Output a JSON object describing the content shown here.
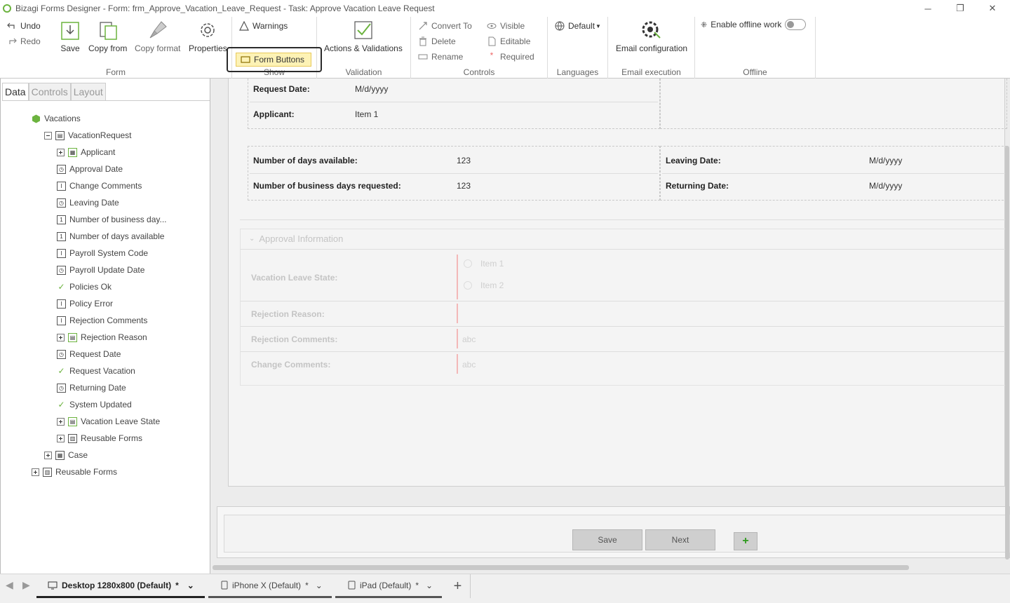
{
  "window": {
    "title": "Bizagi Forms Designer  - Form: frm_Approve_Vacation_Leave_Request - Task:  Approve Vacation Leave Request",
    "minimize": "─",
    "restore": "❐",
    "close": "✕"
  },
  "ribbon": {
    "form": {
      "undo": "Undo",
      "redo": "Redo",
      "save": "Save",
      "copy_from": "Copy from",
      "copy_format": "Copy format",
      "properties": "Properties",
      "label": "Form"
    },
    "show": {
      "warnings": "Warnings",
      "form_buttons": "Form Buttons",
      "label": "Show"
    },
    "validation": {
      "actions": "Actions & Validations",
      "label": "Validation"
    },
    "controls": {
      "convert_to": "Convert To",
      "delete": "Delete",
      "rename": "Rename",
      "visible": "Visible",
      "editable": "Editable",
      "required": "Required",
      "label": "Controls"
    },
    "languages": {
      "default": "Default",
      "label": "Languages"
    },
    "email": {
      "config": "Email configuration",
      "label": "Email execution"
    },
    "offline": {
      "enable": "Enable offline work",
      "label": "Offline"
    }
  },
  "left_panel": {
    "tabs": [
      "Data",
      "Controls",
      "Layout"
    ],
    "tree": [
      {
        "label": "Vacations"
      },
      {
        "label": "VacationRequest"
      },
      {
        "label": "Applicant"
      },
      {
        "label": "Approval Date"
      },
      {
        "label": "Change Comments"
      },
      {
        "label": "Leaving Date"
      },
      {
        "label": "Number of business day..."
      },
      {
        "label": "Number of days available"
      },
      {
        "label": "Payroll System Code"
      },
      {
        "label": "Payroll Update Date"
      },
      {
        "label": "Policies Ok"
      },
      {
        "label": "Policy Error"
      },
      {
        "label": "Rejection Comments"
      },
      {
        "label": "Rejection Reason"
      },
      {
        "label": "Request Date"
      },
      {
        "label": "Request Vacation"
      },
      {
        "label": "Returning Date"
      },
      {
        "label": "System Updated"
      },
      {
        "label": "Vacation Leave State"
      },
      {
        "label": "Reusable Forms"
      },
      {
        "label": "Case"
      },
      {
        "label": "Reusable Forms"
      }
    ]
  },
  "form": {
    "request_date": {
      "label": "Request Date:",
      "value": "M/d/yyyy"
    },
    "applicant": {
      "label": "Applicant:",
      "value": "Item 1"
    },
    "days_available": {
      "label": "Number of days available:",
      "value": "123"
    },
    "business_days": {
      "label": "Number of business days requested:",
      "value": "123"
    },
    "leaving_date": {
      "label": "Leaving Date:",
      "value": "M/d/yyyy"
    },
    "returning_date": {
      "label": "Returning Date:",
      "value": "M/d/yyyy"
    },
    "approval_group": {
      "title": "Approval Information",
      "state_label": "Vacation Leave State:",
      "state_options": [
        "Item 1",
        "Item 2"
      ],
      "rejection_reason_label": "Rejection Reason:",
      "rejection_comments_label": "Rejection Comments:",
      "rejection_comments_value": "abc",
      "change_comments_label": "Change Comments:",
      "change_comments_value": "abc"
    },
    "buttons": {
      "save": "Save",
      "next": "Next",
      "add": "+"
    }
  },
  "bottom_tabs": [
    {
      "label": "Desktop 1280x800 (Default)",
      "modified": "*"
    },
    {
      "label": "iPhone X (Default)",
      "modified": "*"
    },
    {
      "label": "iPad (Default)",
      "modified": "*"
    }
  ],
  "add_tab": "+"
}
